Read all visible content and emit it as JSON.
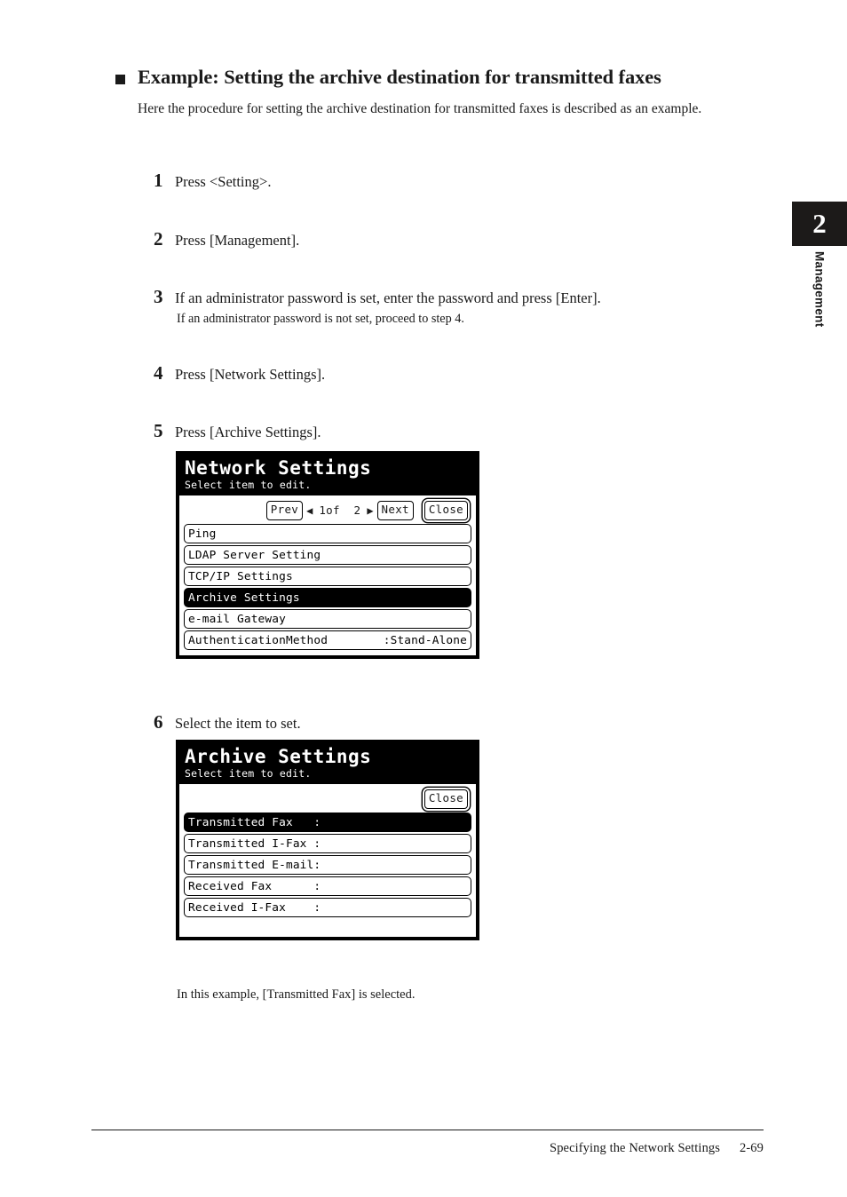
{
  "chapter_tab": {
    "number": "2",
    "label": "Management"
  },
  "heading": {
    "title": "Example: Setting the archive destination for transmitted faxes",
    "intro": "Here the procedure for setting the archive destination for transmitted faxes is described as an example."
  },
  "steps": [
    {
      "number": "1",
      "text": "Press <Setting>."
    },
    {
      "number": "2",
      "text": "Press [Management]."
    },
    {
      "number": "3",
      "text": "If an administrator password is set, enter the password and press [Enter].",
      "note": "If an administrator password is not set, proceed to step 4."
    },
    {
      "number": "4",
      "text": "Press [Network Settings]."
    },
    {
      "number": "5",
      "text": "Press [Archive Settings]."
    },
    {
      "number": "6",
      "text": "Select the item to set."
    }
  ],
  "panel_network": {
    "title": "Network Settings",
    "subtitle": "Select item to edit.",
    "toolbar": {
      "prev_label": "Prev",
      "left_arrow": "◀",
      "page_indicator": "1of  2",
      "right_arrow": "▶",
      "next_label": "Next",
      "close_label": "Close"
    },
    "items": [
      {
        "label": "Ping",
        "value": "",
        "selected": false
      },
      {
        "label": "LDAP Server Setting",
        "value": "",
        "selected": false
      },
      {
        "label": "TCP/IP Settings",
        "value": "",
        "selected": false
      },
      {
        "label": "Archive Settings",
        "value": "",
        "selected": true
      },
      {
        "label": "e-mail Gateway",
        "value": "",
        "selected": false
      },
      {
        "label": "AuthenticationMethod",
        "value": ":Stand-Alone",
        "selected": false
      }
    ]
  },
  "panel_archive": {
    "title": "Archive Settings",
    "subtitle": "Select item to edit.",
    "toolbar": {
      "close_label": "Close"
    },
    "items": [
      {
        "label": "Transmitted Fax   :",
        "value": "",
        "selected": true
      },
      {
        "label": "Transmitted I-Fax :",
        "value": "",
        "selected": false
      },
      {
        "label": "Transmitted E-mail:",
        "value": "",
        "selected": false
      },
      {
        "label": "Received Fax      :",
        "value": "",
        "selected": false
      },
      {
        "label": "Received I-Fax    :",
        "value": "",
        "selected": false
      }
    ]
  },
  "caption": "In this example, [Transmitted Fax] is selected.",
  "footer": {
    "title": "Specifying the Network Settings",
    "page": "2-69"
  },
  "colors": {
    "ink": "#1a1a1a",
    "tab_bg": "#1c1a19",
    "lcd_bg": "#ffffff",
    "lcd_ink": "#000000"
  }
}
